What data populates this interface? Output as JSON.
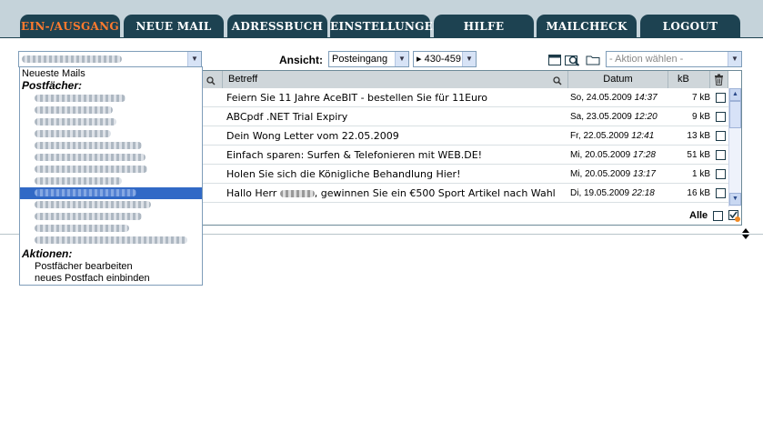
{
  "nav": {
    "tabs": [
      {
        "label": "Ein-/Ausgang",
        "active": true
      },
      {
        "label": "Neue Mail",
        "active": false
      },
      {
        "label": "Adressbuch",
        "active": false
      },
      {
        "label": "Einstellungen",
        "active": false
      },
      {
        "label": "Hilfe",
        "active": false
      },
      {
        "label": "Mailcheck",
        "active": false
      },
      {
        "label": "Logout",
        "active": false
      }
    ]
  },
  "toolbar": {
    "ansicht_label": "Ansicht:",
    "folder_value": "Posteingang",
    "range_value": "▸ 430-459",
    "action_placeholder": "- Aktion wählen -"
  },
  "mailbox_dropdown": {
    "first_item": "Neueste Mails",
    "group_postfaecher": "Postfächer:",
    "group_aktionen": "Aktionen:",
    "action_edit": "Postfächer bearbeiten",
    "action_add": "neues Postfach einbinden"
  },
  "list": {
    "col_subject": "Betreff",
    "col_date": "Datum",
    "col_size": "kB",
    "all_label": "Alle",
    "rows": [
      {
        "subject": "Feiern Sie 11 Jahre AceBIT - bestellen Sie für 11Euro",
        "day": "So, 24.05.2009",
        "time": "14:37",
        "size": "7 kB"
      },
      {
        "subject": "ABCpdf .NET Trial Expiry",
        "day": "Sa, 23.05.2009",
        "time": "12:20",
        "size": "9 kB"
      },
      {
        "subject": "Dein Wong Letter vom 22.05.2009",
        "day": "Fr, 22.05.2009",
        "time": "12:41",
        "size": "13 kB"
      },
      {
        "subject": "Einfach sparen: Surfen & Telefonieren mit WEB.DE!",
        "day": "Mi, 20.05.2009",
        "time": "17:28",
        "size": "51 kB"
      },
      {
        "subject": "Holen Sie sich die Königliche Behandlung Hier!",
        "day": "Mi, 20.05.2009",
        "time": "13:17",
        "size": "1 kB"
      },
      {
        "subject_before": "Hallo Herr",
        "subject_after": ", gewinnen Sie ein €500 Sport Artikel nach Wahl",
        "day": "Di, 19.05.2009",
        "time": "22:18",
        "size": "16 kB"
      }
    ]
  },
  "icons": {
    "window": "window-icon",
    "search": "search-icon",
    "folder": "folder-icon",
    "trash": "trash-icon",
    "sort": "sort-arrows-icon"
  },
  "colors": {
    "nav_bg": "#c5d3da",
    "tab_bg": "#1d4251",
    "tab_active_text": "#ff7a2e",
    "selection": "#3169c6"
  }
}
